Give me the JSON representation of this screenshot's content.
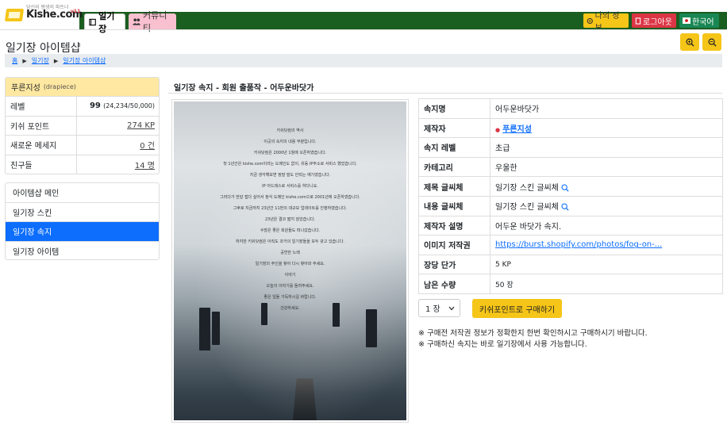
{
  "logo": {
    "tagline": "당신의 평생의 파트너",
    "brand": "Kishe.com",
    "version": "v11"
  },
  "nav": {
    "tabs": [
      {
        "label": "일기장"
      },
      {
        "label": "커뮤니티"
      }
    ]
  },
  "top_buttons": {
    "myinfo": "나의 정보",
    "logout": "로그아웃",
    "language": "한국어"
  },
  "page": {
    "title": "일기장 아이템샵"
  },
  "breadcrumb": [
    "홈",
    "일기장",
    "일기장 아이템샵"
  ],
  "profile": {
    "name": "푸른지성",
    "id": "(drapiece)",
    "rows": [
      {
        "label": "레벨",
        "value": "99",
        "extra": "(24,234/50,000)"
      },
      {
        "label": "키쉬 포인트",
        "value": "274 KP"
      },
      {
        "label": "새로운 메세지",
        "value": "0 건"
      },
      {
        "label": "친구들",
        "value": "14 명"
      }
    ]
  },
  "menu": [
    {
      "label": "아이템샵 메인",
      "active": false
    },
    {
      "label": "일기장 스킨",
      "active": false
    },
    {
      "label": "일기장 속지",
      "active": true
    },
    {
      "label": "일기장 아이템",
      "active": false
    }
  ],
  "item": {
    "title": "일기장 속지 - 회원 출품작 - 어두운바닷가",
    "image_text": [
      "키쉬닷컴의 역사",
      "이곳의 속지의 내용 부분입니다.",
      "키쉬닷컴은 2000년 1월에 오픈하였습니다.",
      "첫 1년간은 kishe.com이라는 도메인도 없이, 유동 IP주소로 서비스 했었습니다.",
      "지금 생각해보면 정말 말도 안되는 얘기였습니다.",
      "IP 어드레스로 서비스를 하다니요.",
      "그러다가 한달 접다 싶어서 정식 도메인 kishe.com으로 2001년에 오픈하였습니다.",
      "그후로 지금까지 23년간 11번의 대규모 업데이트를 진행하였습니다.",
      "23년은 결코 짧지 않았습니다.",
      "수많은 좋은 회원들도 떠나갔습니다.",
      "하지만 키쉬닷컴은 아직도 과거의 일기장들을 모두 갖고 있습니다.",
      "공연한 노래",
      "일기장의 주인을 찾아 다시 찾아와 주세요.",
      "이야기",
      "오늘의 이야기를 들려주세요.",
      "좋은 일들 가득하시길 바랍니다.",
      "건강하세요."
    ],
    "rows": [
      {
        "label": "속지명",
        "value": "어두운바닷가"
      },
      {
        "label": "제작자",
        "value": "푸른지성"
      },
      {
        "label": "속지 레벨",
        "value": "초급"
      },
      {
        "label": "카테고리",
        "value": "우울한"
      },
      {
        "label": "제목 글씨체",
        "value": "일기장 스킨 글씨체"
      },
      {
        "label": "내용 글씨체",
        "value": "일기장 스킨 글씨체"
      },
      {
        "label": "제작자 설명",
        "value": "어두운 바닷가 속지."
      },
      {
        "label": "이미지 저작권",
        "value": "https://burst.shopify.com/photos/fog-on-..."
      },
      {
        "label": "장당 단가",
        "value": "5 KP"
      },
      {
        "label": "남은 수량",
        "value": "50 장"
      }
    ],
    "quantity": "1 장",
    "buy_label": "키쉬포인트로 구매하기",
    "notes": [
      "※ 구매전 저작권 정보가 정확한지 한번 확인하시고 구매하시기 바랍니다.",
      "※ 구매하신 속지는 바로 일기장에서 사용 가능합니다."
    ]
  },
  "colors": {
    "nav_green": "#1a5e20",
    "accent_yellow": "#f5c518",
    "active_blue": "#0d6efd",
    "logout_red": "#dc3545",
    "lang_green": "#198754",
    "profile_header": "#ffe8a1"
  }
}
